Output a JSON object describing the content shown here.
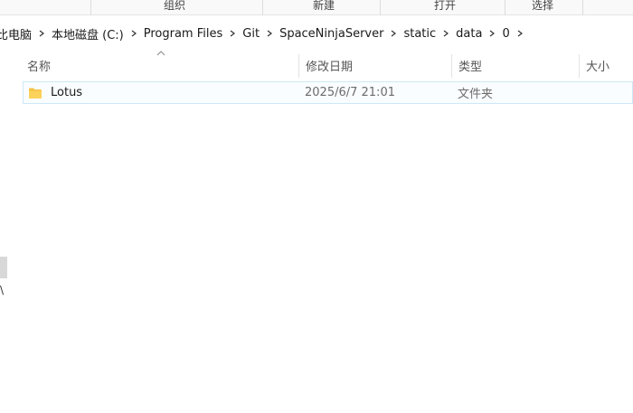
{
  "ribbon": {
    "groups": [
      "组织",
      "新建",
      "打开",
      "选择"
    ]
  },
  "breadcrumb": {
    "items": [
      "比电脑",
      "本地磁盘 (C:)",
      "Program Files",
      "Git",
      "SpaceNinjaServer",
      "static",
      "data",
      "0"
    ]
  },
  "columns": {
    "name": "名称",
    "modified": "修改日期",
    "type": "类型",
    "size": "大小"
  },
  "files": [
    {
      "name": "Lotus",
      "modified": "2025/6/7 21:01",
      "type": "文件夹",
      "size": "",
      "icon": "folder-icon"
    }
  ],
  "nav": {
    "partial_char": "\\"
  },
  "colors": {
    "selection_border": "#cde8f7",
    "folder": "#f4c244"
  }
}
